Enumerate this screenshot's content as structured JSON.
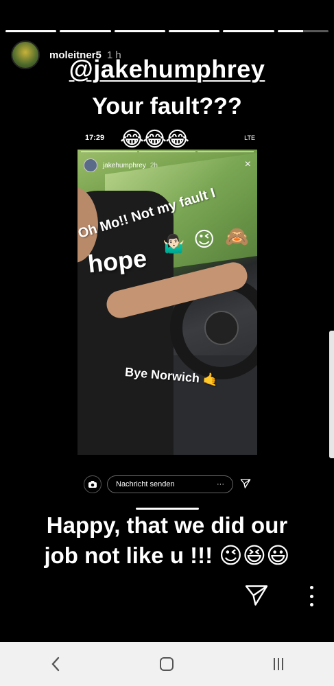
{
  "story": {
    "progress_segments": [
      1,
      1,
      1,
      1,
      1,
      0.5
    ],
    "username": "moleitner5",
    "time": "1 h",
    "mention": "@jakehumphrey",
    "headline": "Your fault???",
    "caption_line1": "Happy, that we did our",
    "caption_line2": "job not like u !!! 😉😆😃"
  },
  "embedded": {
    "clock": "17:29",
    "network": "LTE",
    "emojis_top": "😂😂😂",
    "user": "jakehumphrey",
    "time": "2h",
    "close_icon": "×",
    "sticker_text": "Oh Mo!! Not my fault I",
    "sticker_emoji_1": "🤷🏻‍♂️",
    "sticker_emoji_2": "😉",
    "sticker_emoji_3": "🙈",
    "hope_text": "hope",
    "bye_text": "Bye Norwich 🤙",
    "reply_placeholder": "Nachricht senden",
    "reply_more": "···"
  },
  "icons": {
    "camera": "camera-icon",
    "send": "send-icon",
    "more": "more-vertical-icon",
    "back": "back-icon",
    "home": "home-icon",
    "recents": "recents-icon"
  },
  "navbar": {
    "back_glyph": "‹"
  }
}
